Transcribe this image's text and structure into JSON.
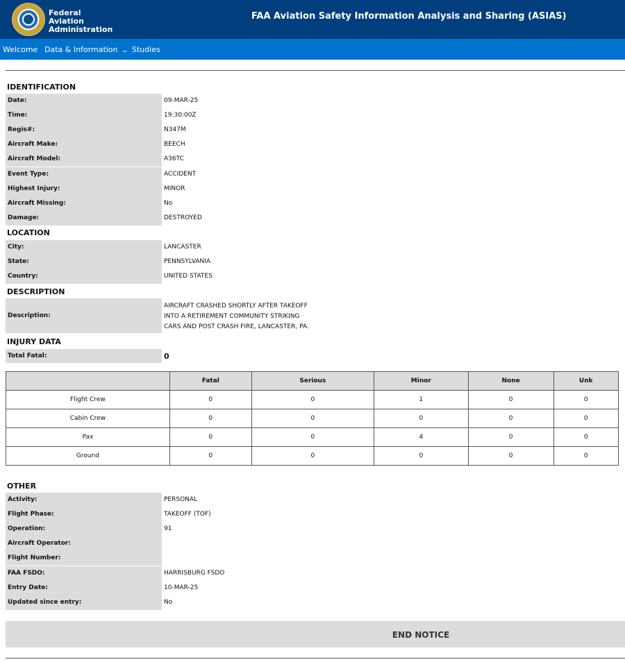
{
  "header": {
    "agency": "Federal Aviation Administration",
    "title": "FAA Aviation Safety Information Analysis and Sharing (ASIAS)"
  },
  "nav": {
    "welcome": "Welcome",
    "data_info": "Data & Information",
    "studies": "Studies"
  },
  "identification": {
    "heading": "IDENTIFICATION",
    "rows": [
      {
        "label": "Date:",
        "value": "09-MAR-25"
      },
      {
        "label": "Time:",
        "value": "19:30:00Z"
      },
      {
        "label": "Regis#:",
        "value": "N347M"
      },
      {
        "label": "Aircraft Make:",
        "value": "BEECH"
      },
      {
        "label": "Aircraft Model:",
        "value": "A36TC"
      },
      {
        "label": "Event Type:",
        "value": "ACCIDENT"
      },
      {
        "label": "Highest Injury:",
        "value": "MINOR"
      },
      {
        "label": "Aircraft Missing:",
        "value": "No"
      },
      {
        "label": "Damage:",
        "value": "DESTROYED"
      }
    ]
  },
  "location": {
    "heading": "LOCATION",
    "rows": [
      {
        "label": "City:",
        "value": "LANCASTER"
      },
      {
        "label": "State:",
        "value": "PENNSYLVANIA"
      },
      {
        "label": "Country:",
        "value": "UNITED STATES"
      }
    ]
  },
  "description": {
    "heading": "DESCRIPTION",
    "label": "Description:",
    "lines": [
      "AIRCRAFT CRASHED SHORTLY AFTER TAKEOFF",
      "INTO A RETIREMENT COMMUNITY STRIKING",
      "CARS AND POST CRASH FIRE, LANCASTER, PA."
    ]
  },
  "injury": {
    "heading": "INJURY DATA",
    "total_label": "Total Fatal:",
    "total_value": "0",
    "columns": [
      "",
      "Fatal",
      "Serious",
      "Minor",
      "None",
      "Unk"
    ],
    "rows": [
      {
        "name": "Flight Crew",
        "values": [
          "0",
          "0",
          "1",
          "0",
          "0"
        ]
      },
      {
        "name": "Cabin Crew",
        "values": [
          "0",
          "0",
          "0",
          "0",
          "0"
        ]
      },
      {
        "name": "Pax",
        "values": [
          "0",
          "0",
          "4",
          "0",
          "0"
        ]
      },
      {
        "name": "Ground",
        "values": [
          "0",
          "0",
          "0",
          "0",
          "0"
        ]
      }
    ]
  },
  "other": {
    "heading": "OTHER",
    "rows": [
      {
        "label": "Activity:",
        "value": "PERSONAL"
      },
      {
        "label": "Flight Phase:",
        "value": "TAKEOFF (TOF)"
      },
      {
        "label": "Operation:",
        "value": "91"
      },
      {
        "label": "Aircraft Operator:",
        "value": ""
      },
      {
        "label": "Flight Number:",
        "value": ""
      },
      {
        "label": "FAA FSDO:",
        "value": "HARRISBURG FSDO"
      },
      {
        "label": "Entry Date:",
        "value": "10-MAR-25"
      },
      {
        "label": "Updated since entry:",
        "value": "No"
      }
    ]
  },
  "end_notice": "END NOTICE"
}
